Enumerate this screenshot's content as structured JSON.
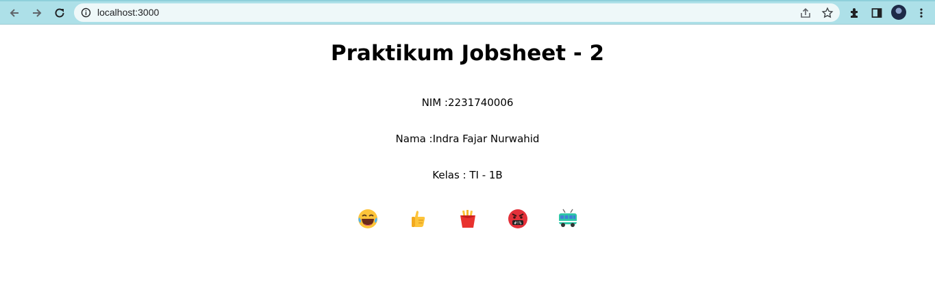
{
  "browser": {
    "url": "localhost:3000"
  },
  "page": {
    "title": "Praktikum Jobsheet - 2",
    "nim": "NIM :2231740006",
    "nama": "Nama :Indra Fajar Nurwahid",
    "kelas": "Kelas : TI - 1B"
  },
  "emojis": [
    "laughing-tears-emoji",
    "thumbs-up-emoji",
    "fries-emoji",
    "cursing-face-emoji",
    "trolleybus-emoji"
  ]
}
